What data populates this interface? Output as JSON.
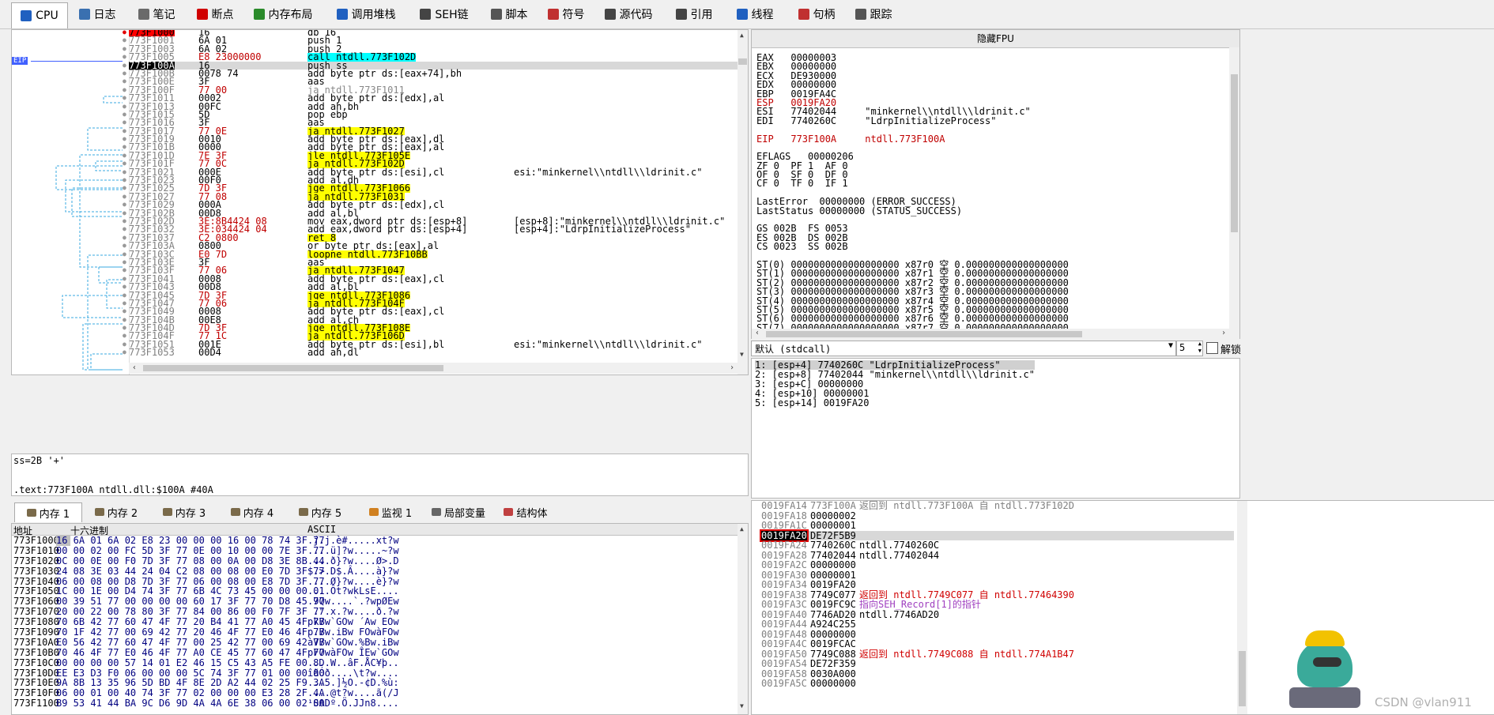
{
  "tabs": [
    {
      "label": "CPU",
      "icon": "cpu-icon",
      "color": "#2060c0",
      "active": true
    },
    {
      "label": "日志",
      "icon": "log-icon",
      "color": "#3a70b0"
    },
    {
      "label": "笔记",
      "icon": "notes-icon",
      "color": "#6a6a6a"
    },
    {
      "label": "断点",
      "icon": "breakpoint-icon",
      "color": "#d00000"
    },
    {
      "label": "内存布局",
      "icon": "memory-map-icon",
      "color": "#2a8a2a"
    },
    {
      "label": "调用堆栈",
      "icon": "call-stack-icon",
      "color": "#2060c0"
    },
    {
      "label": "SEH链",
      "icon": "seh-icon",
      "color": "#444"
    },
    {
      "label": "脚本",
      "icon": "script-icon",
      "color": "#555"
    },
    {
      "label": "符号",
      "icon": "symbols-icon",
      "color": "#c03030"
    },
    {
      "label": "源代码",
      "icon": "source-icon",
      "color": "#444"
    },
    {
      "label": "引用",
      "icon": "references-icon",
      "color": "#444"
    },
    {
      "label": "线程",
      "icon": "threads-icon",
      "color": "#2060c0"
    },
    {
      "label": "句柄",
      "icon": "handles-icon",
      "color": "#c03030"
    },
    {
      "label": "跟踪",
      "icon": "trace-icon",
      "color": "#555"
    }
  ],
  "disasm": {
    "eip_label": "EIP",
    "rows": [
      [
        "773F1000",
        "16",
        "db 16",
        "",
        "red"
      ],
      [
        "773F1001",
        "6A 01",
        "push 1",
        "",
        ""
      ],
      [
        "773F1003",
        "6A 02",
        "push 2",
        "",
        ""
      ],
      [
        "773F1005",
        "E8 23000000",
        "call ntdll.773F102D",
        "",
        "call"
      ],
      [
        "773F100A",
        "16",
        "push ss",
        "",
        "eip"
      ],
      [
        "773F100B",
        "0078 74",
        "add byte ptr ds:[eax+74],bh",
        "",
        ""
      ],
      [
        "773F100E",
        "3F",
        "aas",
        "",
        ""
      ],
      [
        "773F100F",
        "77 00",
        "ja ntdll.773F1011",
        "",
        ""
      ],
      [
        "773F1011",
        "0002",
        "add byte ptr ds:[edx],al",
        "",
        ""
      ],
      [
        "773F1013",
        "00FC",
        "add ah,bh",
        "",
        ""
      ],
      [
        "773F1015",
        "5D",
        "pop ebp",
        "",
        ""
      ],
      [
        "773F1016",
        "3F",
        "aas",
        "",
        ""
      ],
      [
        "773F1017",
        "77 0E",
        "ja ntdll.773F1027",
        "",
        "jmp"
      ],
      [
        "773F1019",
        "0010",
        "add byte ptr ds:[eax],dl",
        "",
        ""
      ],
      [
        "773F101B",
        "0000",
        "add byte ptr ds:[eax],al",
        "",
        ""
      ],
      [
        "773F101D",
        "7E 3F",
        "jle ntdll.773F105E",
        "",
        "jmp"
      ],
      [
        "773F101F",
        "77 0C",
        "ja ntdll.773F102D",
        "",
        "jmp"
      ],
      [
        "773F1021",
        "000E",
        "add byte ptr ds:[esi],cl",
        "esi:\"minkernel\\\\ntdll\\\\ldrinit.c\"",
        ""
      ],
      [
        "773F1023",
        "00F0",
        "add al,dh",
        "",
        ""
      ],
      [
        "773F1025",
        "7D 3F",
        "jge ntdll.773F1066",
        "",
        "jmp"
      ],
      [
        "773F1027",
        "77 08",
        "ja ntdll.773F1031",
        "",
        "jmp"
      ],
      [
        "773F1029",
        "000A",
        "add byte ptr ds:[edx],cl",
        "",
        ""
      ],
      [
        "773F102B",
        "00D8",
        "add al,bl",
        "",
        ""
      ],
      [
        "773F102D",
        "3E:8B4424 08",
        "mov eax,dword ptr ds:[esp+8]",
        "[esp+8]:\"minkernel\\\\ntdll\\\\ldrinit.c\"",
        ""
      ],
      [
        "773F1032",
        "3E:034424 04",
        "add eax,dword ptr ds:[esp+4]",
        "[esp+4]:\"LdrpInitializeProcess\"",
        ""
      ],
      [
        "773F1037",
        "C2 0800",
        "ret 8",
        "",
        "ret"
      ],
      [
        "773F103A",
        "0800",
        "or byte ptr ds:[eax],al",
        "",
        ""
      ],
      [
        "773F103C",
        "E0 7D",
        "loopne ntdll.773F10BB",
        "",
        "jmp"
      ],
      [
        "773F103E",
        "3F",
        "aas",
        "",
        ""
      ],
      [
        "773F103F",
        "77 06",
        "ja ntdll.773F1047",
        "",
        "jmp"
      ],
      [
        "773F1041",
        "0008",
        "add byte ptr ds:[eax],cl",
        "",
        ""
      ],
      [
        "773F1043",
        "00D8",
        "add al,bl",
        "",
        ""
      ],
      [
        "773F1045",
        "7D 3F",
        "jge ntdll.773F1086",
        "",
        "jmp"
      ],
      [
        "773F1047",
        "77 06",
        "ja ntdll.773F104F",
        "",
        "jmp"
      ],
      [
        "773F1049",
        "0008",
        "add byte ptr ds:[eax],cl",
        "",
        ""
      ],
      [
        "773F104B",
        "00E8",
        "add al,ch",
        "",
        ""
      ],
      [
        "773F104D",
        "7D 3F",
        "jge ntdll.773F108E",
        "",
        "jmp"
      ],
      [
        "773F104F",
        "77 1C",
        "ja ntdll.773F106D",
        "",
        "jmp"
      ],
      [
        "773F1051",
        "001E",
        "add byte ptr ds:[esi],bl",
        "esi:\"minkernel\\\\ntdll\\\\ldrinit.c\"",
        ""
      ],
      [
        "773F1053",
        "00D4",
        "add ah,dl",
        "",
        ""
      ]
    ]
  },
  "info": {
    "line1": "ss=2B '+'",
    "line2": ".text:773F100A ntdll.dll:$100A #40A"
  },
  "registers": {
    "title": "隐藏FPU",
    "lines": [
      "EAX   00000003",
      "EBX   00000000",
      "ECX   DE930000",
      "EDX   00000000",
      "EBP   0019FA4C",
      "ESP   0019FA20",
      "ESI   77402044     \"minkernel\\\\ntdll\\\\ldrinit.c\"",
      "EDI   7740260C     \"LdrpInitializeProcess\"",
      "",
      "EIP   773F100A     ntdll.773F100A",
      "",
      "EFLAGS   00000206",
      "ZF 0  PF 1  AF 0",
      "OF 0  SF 0  DF 0",
      "CF 0  TF 0  IF 1",
      "",
      "LastError  00000000 (ERROR_SUCCESS)",
      "LastStatus 00000000 (STATUS_SUCCESS)",
      "",
      "GS 002B  FS 0053",
      "ES 002B  DS 002B",
      "CS 0023  SS 002B",
      "",
      "ST(0) 0000000000000000000 x87r0 空 0.000000000000000000",
      "ST(1) 0000000000000000000 x87r1 空 0.000000000000000000",
      "ST(2) 0000000000000000000 x87r2 空 0.000000000000000000",
      "ST(3) 0000000000000000000 x87r3 空 0.000000000000000000",
      "ST(4) 0000000000000000000 x87r4 空 0.000000000000000000",
      "ST(5) 0000000000000000000 x87r5 空 0.000000000000000000",
      "ST(6) 0000000000000000000 x87r6 空 0.000000000000000000",
      "ST(7) 0000000000000000000 x87r7 空 0.000000000000000000"
    ]
  },
  "callconv": {
    "select": "默认 (stdcall)",
    "count": "5",
    "unlock": "解锁",
    "args": [
      "1: [esp+4] 7740260C \"LdrpInitializeProcess\"",
      "2: [esp+8] 77402044 \"minkernel\\\\ntdll\\\\ldrinit.c\"",
      "3: [esp+C] 00000000",
      "4: [esp+10] 00000001",
      "5: [esp+14] 0019FA20"
    ]
  },
  "memtabs": [
    {
      "label": "内存 1",
      "active": true
    },
    {
      "label": "内存 2"
    },
    {
      "label": "内存 3"
    },
    {
      "label": "内存 4"
    },
    {
      "label": "内存 5"
    },
    {
      "label": "监视 1"
    },
    {
      "label": "局部变量"
    },
    {
      "label": "结构体"
    }
  ],
  "dump": {
    "headers": {
      "addr": "地址",
      "hex": "十六进制",
      "ascii": "ASCII"
    },
    "rows": [
      [
        "773F1000",
        "16 6A 01 6A 02 E8 23 00 00 00 16 00 78 74 3F 77",
        ".j.j.è#.....xt?w"
      ],
      [
        "773F1010",
        "00 00 02 00 FC 5D 3F 77 0E 00 10 00 00 7E 3F 77",
        "....ü]?w.....~?w"
      ],
      [
        "773F1020",
        "0C 00 0E 00 F0 7D 3F 77 08 00 0A 00 D8 3E 8B 44",
        "....ð}?w....Ø>.D"
      ],
      [
        "773F1030",
        "24 08 3E 03 44 24 04 C2 08 00 08 00 E0 7D 3F 77",
        "$.>.D$.Â....à}?w"
      ],
      [
        "773F1040",
        "06 00 08 00 D8 7D 3F 77 06 00 08 00 E8 7D 3F 77",
        "....Ø}?w....è}?w"
      ],
      [
        "773F1050",
        "1C 00 1E 00 D4 74 3F 77 6B 4C 73 45 00 00 00 01",
        "....Ôt?wkLsE...."
      ],
      [
        "773F1060",
        "00 39 51 77 00 00 00 00 60 17 3F 77 70 D8 45 77",
        ".9Qw....`.?wpØEw"
      ],
      [
        "773F1070",
        "20 00 22 00 78 80 3F 77 84 00 86 00 F0 7F 3F 77",
        " .\".x.?w....ð.?w"
      ],
      [
        "773F1080",
        "70 6B 42 77 60 47 4F 77 20 B4 41 77 A0 45 4F 77",
        "pkBw`GOw ´Aw EOw"
      ],
      [
        "773F1090",
        "70 1F 42 77 00 69 42 77 20 46 4F 77 E0 46 4F 77",
        "p.Bw.iBw FOwàFOw"
      ],
      [
        "773F10A0",
        "E0 56 42 77 60 47 4F 77 00 25 42 77 00 69 42 77",
        "àVBw`GOw.%Bw.iBw"
      ],
      [
        "773F10B0",
        "70 46 4F 77 E0 46 4F 77 A0 CE 45 77 60 47 4F 77",
        "pFOwàFOw ÎEw`GOw"
      ],
      [
        "773F10C0",
        "00 00 00 00 57 14 01 E2 46 15 C5 43 A5 FE 00 8D",
        "....W..âF.ÅC¥þ.."
      ],
      [
        "773F10D0",
        "EE E3 D3 F0 06 00 00 00 5C 74 3F 77 01 00 00 00",
        "îãÓð....\\t?w...."
      ],
      [
        "773F10E0",
        "9A 8B 13 35 96 5D BD 4F 8E 2D A2 44 02 25 F9 3A",
        "...5.]½O.-¢D.%ù:"
      ],
      [
        "773F10F0",
        "06 00 01 00 40 74 3F 77 02 00 00 00 E3 28 2F 4A",
        "....@t?w....ã(/J"
      ],
      [
        "773F1100",
        "B9 53 41 44 BA 9C D6 9D 4A 4A 6E 38 06 00 02 00",
        "¹SADº.Ö.JJn8...."
      ]
    ]
  },
  "stack": {
    "rows": [
      [
        "0019FA14",
        "773F100A",
        "返回到 ntdll.773F100A 自 ntdll.773F102D",
        "ret-grey"
      ],
      [
        "0019FA18",
        "00000002",
        "",
        ""
      ],
      [
        "0019FA1C",
        "00000001",
        "",
        ""
      ],
      [
        "0019FA20",
        "DE72F5B9",
        "",
        "esp"
      ],
      [
        "0019FA24",
        "7740260C",
        "ntdll.7740260C",
        ""
      ],
      [
        "0019FA28",
        "77402044",
        "ntdll.77402044",
        ""
      ],
      [
        "0019FA2C",
        "00000000",
        "",
        ""
      ],
      [
        "0019FA30",
        "00000001",
        "",
        ""
      ],
      [
        "0019FA34",
        "0019FA20",
        "",
        ""
      ],
      [
        "0019FA38",
        "7749C077",
        "返回到 ntdll.7749C077 自 ntdll.77464390",
        "ret"
      ],
      [
        "0019FA3C",
        "0019FC9C",
        "指向SEH_Record[1]的指针",
        "purple"
      ],
      [
        "0019FA40",
        "7746AD20",
        "ntdll.7746AD20",
        ""
      ],
      [
        "0019FA44",
        "A924C255",
        "",
        ""
      ],
      [
        "0019FA48",
        "00000000",
        "",
        ""
      ],
      [
        "0019FA4C",
        "0019FCAC",
        "",
        ""
      ],
      [
        "0019FA50",
        "7749C088",
        "返回到 ntdll.7749C088 自 ntdll.774A1B47",
        "ret"
      ],
      [
        "0019FA54",
        "DE72F359",
        "",
        ""
      ],
      [
        "0019FA58",
        "0030A000",
        "",
        ""
      ],
      [
        "0019FA5C",
        "00000000",
        "",
        ""
      ]
    ]
  },
  "watermark": "CSDN @vlan911"
}
